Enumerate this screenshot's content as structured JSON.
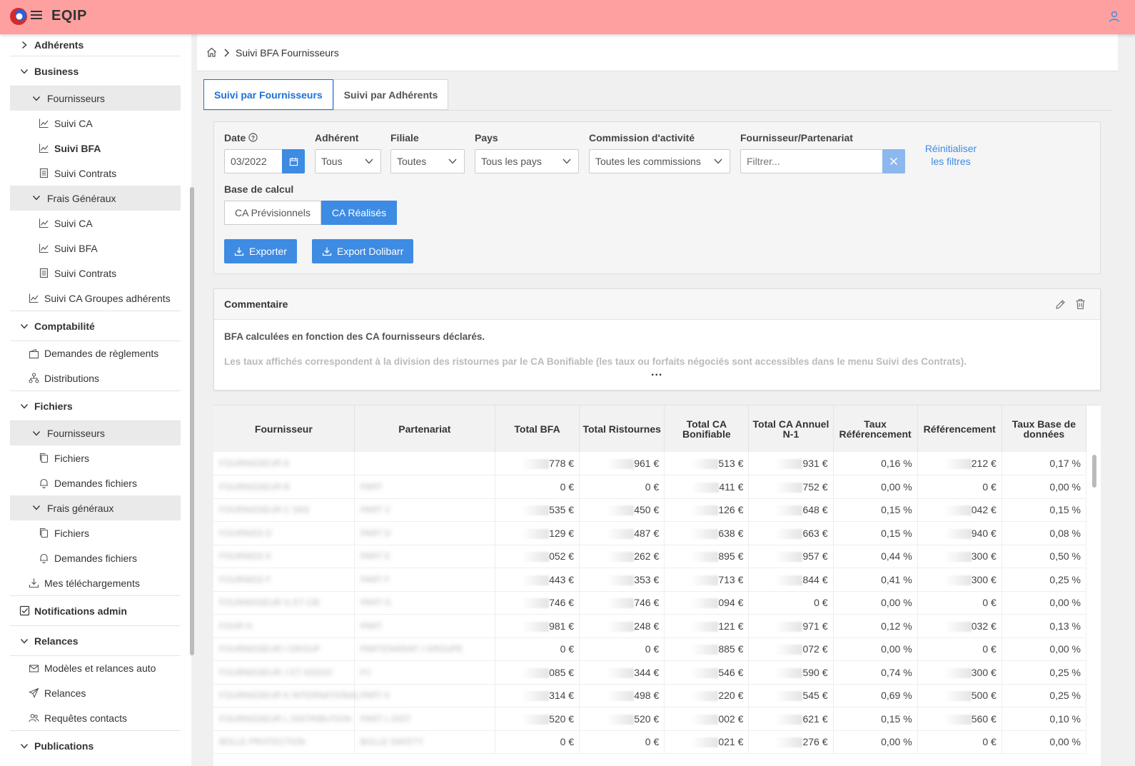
{
  "app": {
    "brand": "EQIP"
  },
  "sidebar": {
    "items": [
      {
        "type": "section",
        "label": "Adhérents",
        "expanded": false
      },
      {
        "type": "section",
        "label": "Business",
        "expanded": true
      },
      {
        "type": "group",
        "label": "Fournisseurs"
      },
      {
        "type": "leaf",
        "label": "Suivi CA",
        "icon": "chart-icon"
      },
      {
        "type": "leaf",
        "label": "Suivi BFA",
        "icon": "chart-icon",
        "active": true
      },
      {
        "type": "leaf",
        "label": "Suivi Contrats",
        "icon": "document-icon"
      },
      {
        "type": "group",
        "label": "Frais Généraux"
      },
      {
        "type": "leaf",
        "label": "Suivi CA",
        "icon": "chart-icon"
      },
      {
        "type": "leaf",
        "label": "Suivi BFA",
        "icon": "chart-icon"
      },
      {
        "type": "leaf",
        "label": "Suivi Contrats",
        "icon": "document-icon"
      },
      {
        "type": "leaf1",
        "label": "Suivi CA Groupes adhérents",
        "icon": "chart-icon"
      },
      {
        "type": "section",
        "label": "Comptabilité",
        "expanded": true
      },
      {
        "type": "leaf1",
        "label": "Demandes de règlements",
        "icon": "wallet-icon"
      },
      {
        "type": "leaf1",
        "label": "Distributions",
        "icon": "network-icon"
      },
      {
        "type": "section",
        "label": "Fichiers",
        "expanded": true
      },
      {
        "type": "group",
        "label": "Fournisseurs"
      },
      {
        "type": "leaf",
        "label": "Fichiers",
        "icon": "files-icon"
      },
      {
        "type": "leaf",
        "label": "Demandes fichiers",
        "icon": "bell-icon"
      },
      {
        "type": "group",
        "label": "Frais généraux"
      },
      {
        "type": "leaf",
        "label": "Fichiers",
        "icon": "files-icon"
      },
      {
        "type": "leaf",
        "label": "Demandes fichiers",
        "icon": "bell-icon"
      },
      {
        "type": "leaf1",
        "label": "Mes téléchargements",
        "icon": "download-icon"
      },
      {
        "type": "section-icon",
        "label": "Notifications admin",
        "icon": "checkbox-icon"
      },
      {
        "type": "section",
        "label": "Relances",
        "expanded": true
      },
      {
        "type": "leaf1",
        "label": "Modèles et relances auto",
        "icon": "mail-icon"
      },
      {
        "type": "leaf1",
        "label": "Relances",
        "icon": "send-icon"
      },
      {
        "type": "leaf1",
        "label": "Requêtes contacts",
        "icon": "contacts-icon"
      },
      {
        "type": "section",
        "label": "Publications",
        "expanded": true
      }
    ]
  },
  "breadcrumb": {
    "current": "Suivi BFA Fournisseurs"
  },
  "tabs": [
    {
      "label": "Suivi par Fournisseurs",
      "active": true
    },
    {
      "label": "Suivi par Adhérents",
      "active": false
    }
  ],
  "filters": {
    "date_label": "Date",
    "date_value": "03/2022",
    "adherent_label": "Adhérent",
    "adherent_value": "Tous",
    "filiale_label": "Filiale",
    "filiale_value": "Toutes",
    "pays_label": "Pays",
    "pays_value": "Tous les pays",
    "commission_label": "Commission d'activité",
    "commission_value": "Toutes les commissions",
    "fournisseur_label": "Fournisseur/Partenariat",
    "fournisseur_placeholder": "Filtrer...",
    "reset_line1": "Réinitialiser",
    "reset_line2": "les filtres",
    "base_label": "Base de calcul",
    "base_options": [
      "CA Prévisionnels",
      "CA Réalisés"
    ],
    "base_selected": "CA Réalisés",
    "export_label": "Exporter",
    "export_dolibarr_label": "Export Dolibarr"
  },
  "comment": {
    "title": "Commentaire",
    "line1": "BFA calculées en fonction des CA fournisseurs déclarés.",
    "line2": "Les taux affichés correspondent à la division des ristournes par le CA Bonifiable (les taux ou forfaits négociés sont accessibles dans le menu Suivi des Contrats).",
    "more": "..."
  },
  "table": {
    "columns": [
      "Fournisseur",
      "Partenariat",
      "Total BFA",
      "Total Ristournes",
      "Total CA Bonifiable",
      "Total CA Annuel N-1",
      "Taux Référencement",
      "Référencement",
      "Taux Base de données"
    ],
    "rows": [
      [
        "FOURNISSEUR A",
        "",
        "778 €",
        "961 €",
        "513 €",
        "931 €",
        "0,16 %",
        "212 €",
        "0,17 %"
      ],
      [
        "FOURNISSEUR B",
        "PART",
        "0 €",
        "0 €",
        "411 €",
        "752 €",
        "0,00 %",
        "0 €",
        "0,00 %"
      ],
      [
        "FOURNISSEUR C SAS",
        "PART C",
        "535 €",
        "450 €",
        "126 €",
        "648 €",
        "0,15 %",
        "042 €",
        "0,15 %"
      ],
      [
        "FOURNISS D",
        "PART D",
        "129 €",
        "487 €",
        "638 €",
        "663 €",
        "0,15 %",
        "940 €",
        "0,08 %"
      ],
      [
        "FOURNISS E",
        "PART E",
        "052 €",
        "262 €",
        "895 €",
        "957 €",
        "0,44 %",
        "300 €",
        "0,50 %"
      ],
      [
        "FOURNISS F",
        "PART F",
        "443 €",
        "353 €",
        "713 €",
        "844 €",
        "0,41 %",
        "300 €",
        "0,25 %"
      ],
      [
        "FOURNISSEUR G ET CIE",
        "PART G",
        "746 €",
        "746 €",
        "094 €",
        "0 €",
        "0,00 %",
        "0 €",
        "0,00 %"
      ],
      [
        "FOUR H",
        "PART",
        "981 €",
        "248 €",
        "121 €",
        "971 €",
        "0,12 %",
        "032 €",
        "0,13 %"
      ],
      [
        "FOURNISSEUR I GROUP",
        "PARTENARIAT I GROUPE",
        "0 €",
        "0 €",
        "885 €",
        "072 €",
        "0,00 %",
        "0 €",
        "0,00 %"
      ],
      [
        "FOURNISSEUR J ET ASSOC",
        "PJ",
        "085 €",
        "344 €",
        "546 €",
        "590 €",
        "0,74 %",
        "300 €",
        "0,25 %"
      ],
      [
        "FOURNISSEUR K INTERNATIONAL",
        "PART K",
        "314 €",
        "498 €",
        "220 €",
        "545 €",
        "0,69 %",
        "500 €",
        "0,25 %"
      ],
      [
        "FOURNISSEUR L DISTRIBUTION",
        "PART L DIST",
        "520 €",
        "520 €",
        "002 €",
        "621 €",
        "0,15 %",
        "560 €",
        "0,10 %"
      ],
      [
        "BOLLE PROTECTION",
        "BOLLE SAFETY",
        "0 €",
        "0 €",
        "021 €",
        "276 €",
        "0,00 %",
        "0 €",
        "0,00 %"
      ]
    ]
  },
  "colors": {
    "topbar": "#ffa0a0",
    "accent": "#3d8be3"
  }
}
